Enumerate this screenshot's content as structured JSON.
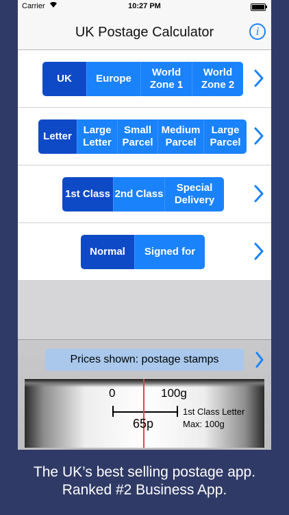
{
  "status": {
    "carrier": "Carrier",
    "time": "10:27 PM"
  },
  "nav": {
    "title": "UK Postage Calculator",
    "info_label": "i"
  },
  "destination": {
    "options": [
      "UK",
      "Europe",
      "World Zone 1",
      "World Zone 2"
    ],
    "selected": "UK"
  },
  "format": {
    "options": [
      "Letter",
      "Large Letter",
      "Small Parcel",
      "Medium Parcel",
      "Large Parcel"
    ],
    "selected": "Letter"
  },
  "service": {
    "options": [
      "1st Class",
      "2nd Class",
      "Special Delivery"
    ],
    "selected": "1st Class"
  },
  "signature": {
    "options": [
      "Normal",
      "Signed for"
    ],
    "selected": "Normal"
  },
  "prices": {
    "label": "Prices shown: postage stamps"
  },
  "scale": {
    "min_label": "0",
    "max_label": "100g",
    "price": "65p",
    "description_line1": "1st Class Letter",
    "description_line2": "Max: 100g"
  },
  "caption": {
    "line1": "The UK’s best selling postage app.",
    "line2": "Ranked #2 Business App."
  },
  "colors": {
    "accent": "#1a82fb",
    "selected": "#0f4ac6",
    "background": "#2f3a66",
    "needle": "#e0483a"
  }
}
